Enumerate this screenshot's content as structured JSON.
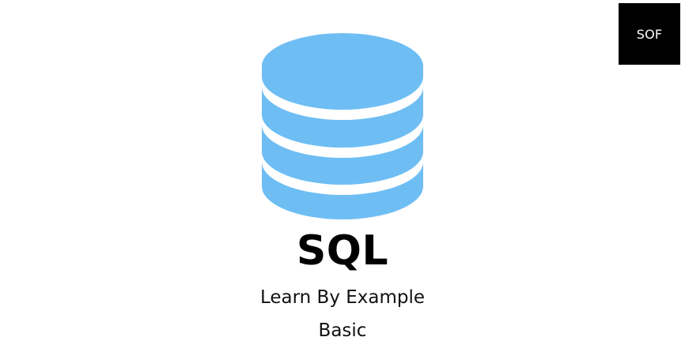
{
  "badge": {
    "label": "SOF"
  },
  "icon": {
    "name": "database-icon",
    "color": "#6ebef4"
  },
  "title": "SQL",
  "subtitle": "Learn By Example",
  "level": "Basic"
}
